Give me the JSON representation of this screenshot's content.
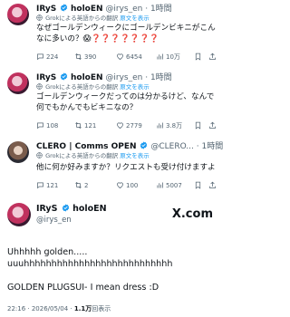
{
  "tweets": [
    {
      "name": "IRyS",
      "handle": "holoEN @irys_en · 1時間",
      "translate_note": "Grokによる英語からの翻訳",
      "translate_link": "原文を表示",
      "text": "なぜゴールデンウィークにゴールデンビキニがこんなに多いの？😱❓❓❓❓❓❓❓",
      "replies": "224",
      "retweets": "390",
      "likes": "6454",
      "views": "10万"
    },
    {
      "name": "IRyS",
      "handle": "holoEN @irys_en · 1時間",
      "translate_note": "Grokによる英語からの翻訳",
      "translate_link": "原文を表示",
      "text": "ゴールデンウィークだってのは分かるけど、なんで何でもかんでもビキニなの？",
      "replies": "108",
      "retweets": "121",
      "likes": "2779",
      "views": "3.8万"
    },
    {
      "name": "CLERO | Comms OPEN",
      "handle": "@CLERO... · 1時間",
      "translate_note": "Grokによる英語からの翻訳",
      "translate_link": "原文を表示",
      "text": "他に何か好みますか？リクエストも受け付けますよ",
      "replies": "121",
      "retweets": "2",
      "likes": "100",
      "views": "5007"
    }
  ],
  "main_tweet": {
    "name": "IRyS",
    "name_suffix": "holoEN",
    "handle": "@irys_en",
    "brand": "X.com",
    "text": "Uhhhhh golden.....\nuuuhhhhhhhhhhhhhhhhhhhhhhhhhhh\n\nGOLDEN PLUGSUI- I mean dress :D",
    "time": "22:16 · 2026/05/04 · ",
    "views": "1.1万",
    "views_label": "回表示"
  },
  "colors": {
    "link": "#1d9bf0",
    "verified": "#1d9bf0",
    "muted": "#536471",
    "thread_line": "#cfd9de"
  }
}
